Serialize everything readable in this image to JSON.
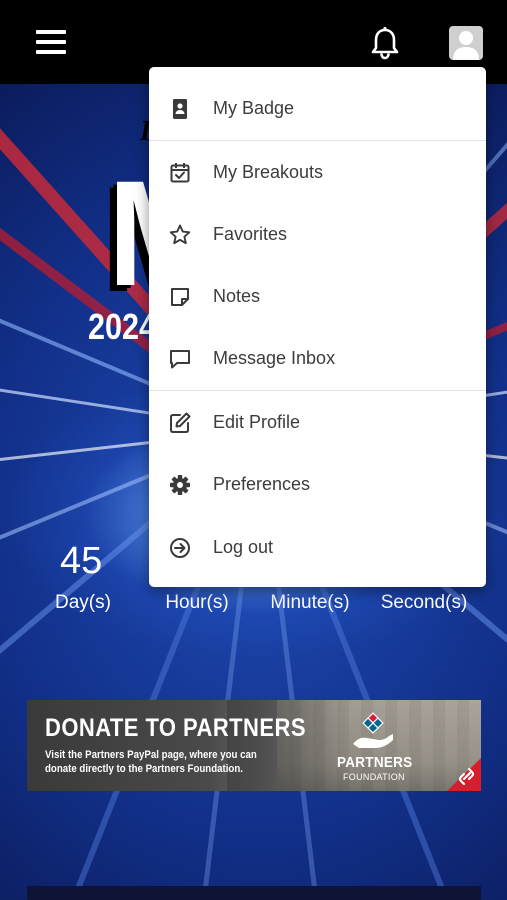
{
  "header": {
    "menu_icon": "hamburger-icon",
    "notifications_icon": "bell-icon",
    "profile_icon": "user-avatar-icon"
  },
  "hero": {
    "logo_text_small": "I",
    "logo_letter": "M",
    "logo_year": "2024"
  },
  "countdown": {
    "days_value": "45",
    "days_label": "Day(s)",
    "hours_label": "Hour(s)",
    "minutes_label": "Minute(s)",
    "seconds_label": "Second(s)"
  },
  "banner": {
    "title": "DONATE TO PARTNERS",
    "text": "Visit the Partners PayPal page, where you can donate directly to the Partners Foundation.",
    "brand": "PARTNERS",
    "brand_sub": "FOUNDATION",
    "link_icon": "link-icon"
  },
  "menu": {
    "items": [
      {
        "label": "My Badge",
        "icon": "badge-icon"
      },
      {
        "label": "My Breakouts",
        "icon": "calendar-check-icon"
      },
      {
        "label": "Favorites",
        "icon": "star-icon"
      },
      {
        "label": "Notes",
        "icon": "note-icon"
      },
      {
        "label": "Message Inbox",
        "icon": "message-icon"
      },
      {
        "label": "Edit Profile",
        "icon": "edit-icon"
      },
      {
        "label": "Preferences",
        "icon": "gear-icon"
      },
      {
        "label": "Log out",
        "icon": "logout-icon"
      }
    ]
  },
  "colors": {
    "topbar": "#000000",
    "menu_text": "#3c3c3c",
    "hero_blue": "#1e4bb4"
  }
}
